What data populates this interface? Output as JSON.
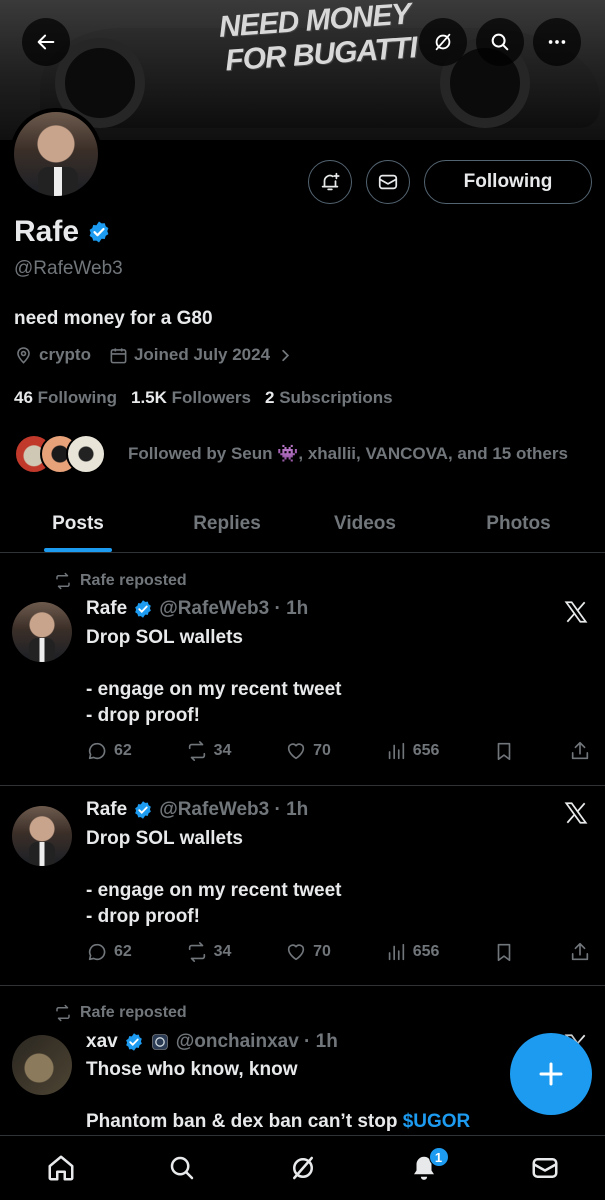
{
  "banner": {
    "line1": "NEED MONEY",
    "line2": "FOR BUGATTI"
  },
  "header": {
    "back_icon": "arrow-left-icon",
    "grok_icon": "grok-icon",
    "search_icon": "search-icon",
    "more_icon": "more-dots-icon"
  },
  "profile": {
    "name": "Rafe",
    "handle": "@RafeWeb3",
    "bio": "need money for a G80",
    "location": "crypto",
    "joined": "Joined July 2024",
    "following_count": "46",
    "following_label": "Following",
    "followers_count": "1.5K",
    "followers_label": "Followers",
    "subscriptions_count": "2",
    "subscriptions_label": "Subscriptions",
    "followed_by": "Followed by Seun 👾, xhallii, VANCOVA, and 15 others",
    "following_button": "Following"
  },
  "tabs": [
    {
      "label": "Posts"
    },
    {
      "label": "Replies"
    },
    {
      "label": "Videos"
    },
    {
      "label": "Photos"
    }
  ],
  "posts": [
    {
      "repost_label": "Rafe reposted",
      "name": "Rafe",
      "handle_time": "@RafeWeb3 · 1h",
      "text": "Drop SOL wallets\n\n- engage on my recent tweet\n- drop proof!",
      "replies": "62",
      "reposts": "34",
      "likes": "70",
      "views": "656"
    },
    {
      "name": "Rafe",
      "handle_time": "@RafeWeb3 · 1h",
      "text": "Drop SOL wallets\n\n- engage on my recent tweet\n- drop proof!",
      "replies": "62",
      "reposts": "34",
      "likes": "70",
      "views": "656"
    },
    {
      "repost_label": "Rafe reposted",
      "name": "xav",
      "handle_time": "@onchainxav · 1h",
      "text_line1": "Those who know, know",
      "text_line3": "Phantom ban & dex ban can’t stop ",
      "cashtag": "$UGOR"
    }
  ],
  "nav": {
    "notifications_badge": "1"
  },
  "colors": {
    "accent": "#1d9bf0",
    "muted": "#71767b",
    "text": "#e7e9ea",
    "border": "#2f3336"
  }
}
